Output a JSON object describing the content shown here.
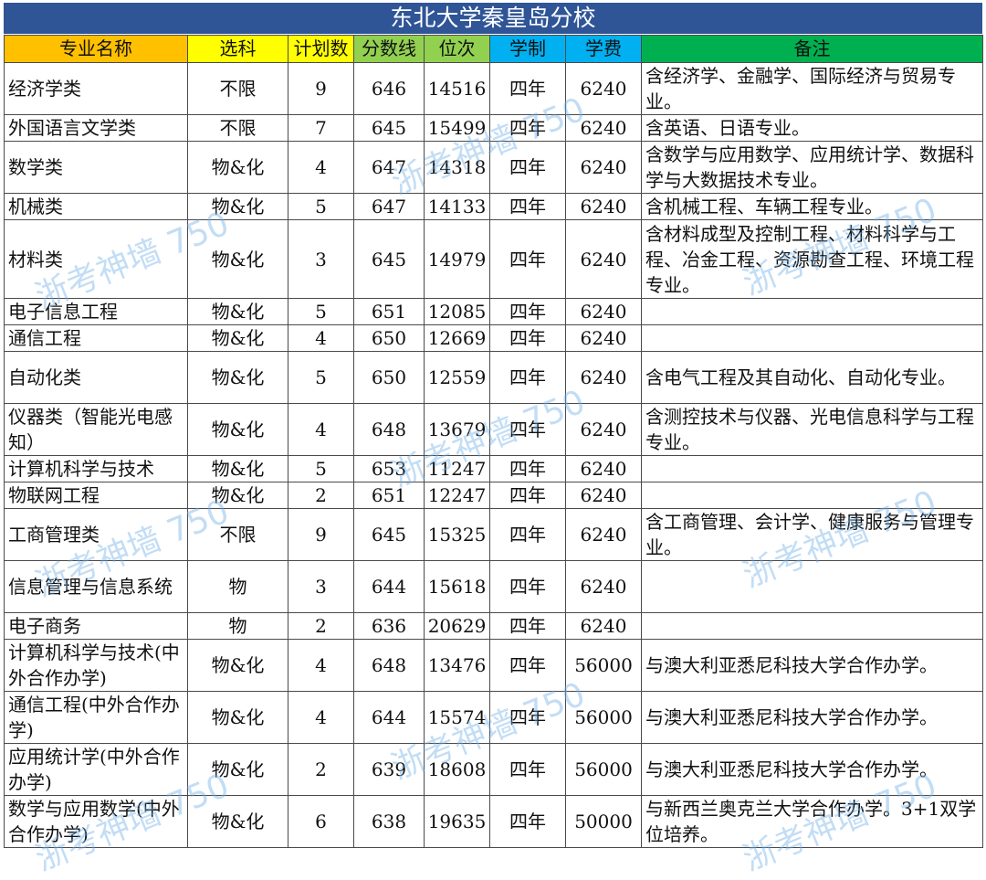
{
  "title": "东北大学秦皇岛分校",
  "header_colors": [
    "#ffc000",
    "#ffff00",
    "#ffff00",
    "#92d050",
    "#92d050",
    "#00b0f0",
    "#00b0f0",
    "#00b050"
  ],
  "headers": [
    "专业名称",
    "选科",
    "计划数",
    "分数线",
    "位次",
    "学制",
    "学费",
    "备注"
  ],
  "rows": [
    {
      "name": "经济学类",
      "subject": "不限",
      "plan": "9",
      "score": "646",
      "rank": "14516",
      "years": "四年",
      "fee": "6240",
      "note": "含经济学、金融学、国际经济与贸易专业。"
    },
    {
      "name": "外国语言文学类",
      "subject": "不限",
      "plan": "7",
      "score": "645",
      "rank": "15499",
      "years": "四年",
      "fee": "6240",
      "note": "含英语、日语专业。"
    },
    {
      "name": "数学类",
      "subject": "物&化",
      "plan": "4",
      "score": "647",
      "rank": "14318",
      "years": "四年",
      "fee": "6240",
      "note": "含数学与应用数学、应用统计学、数据科学与大数据技术专业。"
    },
    {
      "name": "机械类",
      "subject": "物&化",
      "plan": "5",
      "score": "647",
      "rank": "14133",
      "years": "四年",
      "fee": "6240",
      "note": "含机械工程、车辆工程专业。"
    },
    {
      "name": "材料类",
      "subject": "物&化",
      "plan": "3",
      "score": "645",
      "rank": "14979",
      "years": "四年",
      "fee": "6240",
      "note": "含材料成型及控制工程、材料科学与工程、冶金工程、资源勘查工程、环境工程专业。"
    },
    {
      "name": "电子信息工程",
      "subject": "物&化",
      "plan": "5",
      "score": "651",
      "rank": "12085",
      "years": "四年",
      "fee": "6240",
      "note": ""
    },
    {
      "name": "通信工程",
      "subject": "物&化",
      "plan": "4",
      "score": "650",
      "rank": "12669",
      "years": "四年",
      "fee": "6240",
      "note": ""
    },
    {
      "name": "自动化类",
      "subject": "物&化",
      "plan": "5",
      "score": "650",
      "rank": "12559",
      "years": "四年",
      "fee": "6240",
      "note": "含电气工程及其自动化、自动化专业。"
    },
    {
      "name": "仪器类（智能光电感知）",
      "subject": "物&化",
      "plan": "4",
      "score": "648",
      "rank": "13679",
      "years": "四年",
      "fee": "6240",
      "note": "含测控技术与仪器、光电信息科学与工程专业。"
    },
    {
      "name": "计算机科学与技术",
      "subject": "物&化",
      "plan": "5",
      "score": "653",
      "rank": "11247",
      "years": "四年",
      "fee": "6240",
      "note": ""
    },
    {
      "name": "物联网工程",
      "subject": "物&化",
      "plan": "2",
      "score": "651",
      "rank": "12247",
      "years": "四年",
      "fee": "6240",
      "note": ""
    },
    {
      "name": "工商管理类",
      "subject": "不限",
      "plan": "9",
      "score": "645",
      "rank": "15325",
      "years": "四年",
      "fee": "6240",
      "note": "含工商管理、会计学、健康服务与管理专业。"
    },
    {
      "name": "信息管理与信息系统",
      "subject": "物",
      "plan": "3",
      "score": "644",
      "rank": "15618",
      "years": "四年",
      "fee": "6240",
      "note": ""
    },
    {
      "name": "电子商务",
      "subject": "物",
      "plan": "2",
      "score": "636",
      "rank": "20629",
      "years": "四年",
      "fee": "6240",
      "note": ""
    },
    {
      "name": "计算机科学与技术(中外合作办学)",
      "subject": "物&化",
      "plan": "4",
      "score": "648",
      "rank": "13476",
      "years": "四年",
      "fee": "56000",
      "note": "与澳大利亚悉尼科技大学合作办学。"
    },
    {
      "name": "通信工程(中外合作办学)",
      "subject": "物&化",
      "plan": "4",
      "score": "644",
      "rank": "15574",
      "years": "四年",
      "fee": "56000",
      "note": "与澳大利亚悉尼科技大学合作办学。"
    },
    {
      "name": "应用统计学(中外合作办学)",
      "subject": "物&化",
      "plan": "2",
      "score": "639",
      "rank": "18608",
      "years": "四年",
      "fee": "56000",
      "note": "与澳大利亚悉尼科技大学合作办学。"
    },
    {
      "name": "数学与应用数学(中外合作办学)",
      "subject": "物&化",
      "plan": "6",
      "score": "638",
      "rank": "19635",
      "years": "四年",
      "fee": "50000",
      "note": "与新西兰奥克兰大学合作办学。3+1双学位培养。"
    }
  ],
  "watermark": "浙考神墙 750"
}
